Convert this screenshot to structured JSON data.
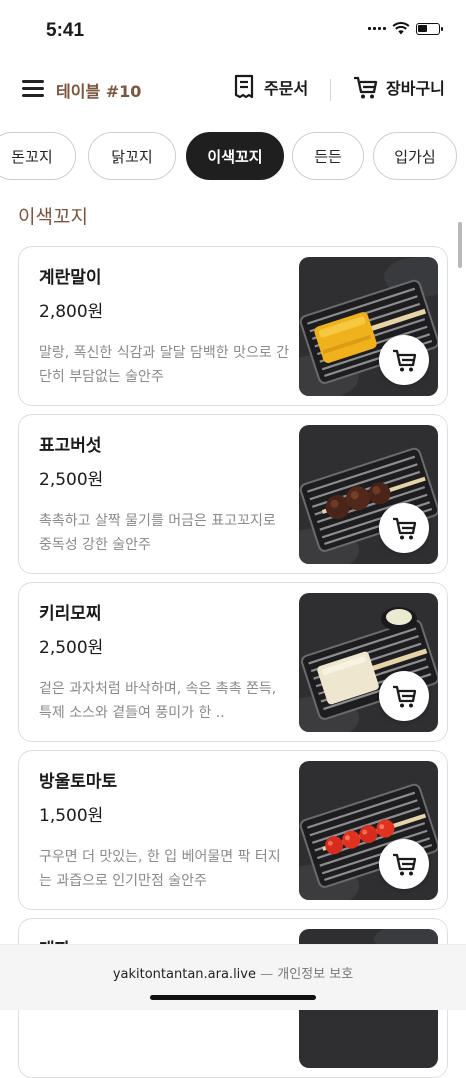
{
  "status": {
    "time": "5:41"
  },
  "header": {
    "table_label": "테이블 #10",
    "order_label": "주문서",
    "cart_label": "장바구니"
  },
  "tabs": [
    {
      "label": "돈꼬지",
      "active": false
    },
    {
      "label": "닭꼬지",
      "active": false
    },
    {
      "label": "이색꼬지",
      "active": true
    },
    {
      "label": "든든",
      "active": false
    },
    {
      "label": "입가심",
      "active": false
    }
  ],
  "section": {
    "title": "이색꼬지"
  },
  "items": [
    {
      "name": "계란말이",
      "price": "2,800원",
      "description": "말랑, 폭신한 식감과 달달 담백한 맛으로 간단히 부담없는 술안주"
    },
    {
      "name": "표고버섯",
      "price": "2,500원",
      "description": "촉촉하고 살짝 물기를 머금은 표고꼬지로 중독성 강한 술안주"
    },
    {
      "name": "키리모찌",
      "price": "2,500원",
      "description": "겉은 과자처럼 바삭하며, 속은 촉촉 쫀득, 특제 소스와 곁들여 풍미가 한 .."
    },
    {
      "name": "방울토마토",
      "price": "1,500원",
      "description": "구우면 더 맛있는, 한 입 베어물면 팍 터지는 과즙으로 인기만점 술안주"
    },
    {
      "name": "대파",
      "price": "",
      "description": ""
    }
  ],
  "footer": {
    "domain": "yakitontantan.ara.live",
    "separator": "—",
    "privacy": "개인정보 보호"
  },
  "colors": {
    "accent_brown": "#7a5640",
    "active_tab": "#1f1f1f",
    "muted_text": "#8a8a8a"
  },
  "icons": [
    "hamburger-menu-icon",
    "receipt-icon",
    "cart-icon",
    "wifi-icon",
    "battery-icon"
  ]
}
